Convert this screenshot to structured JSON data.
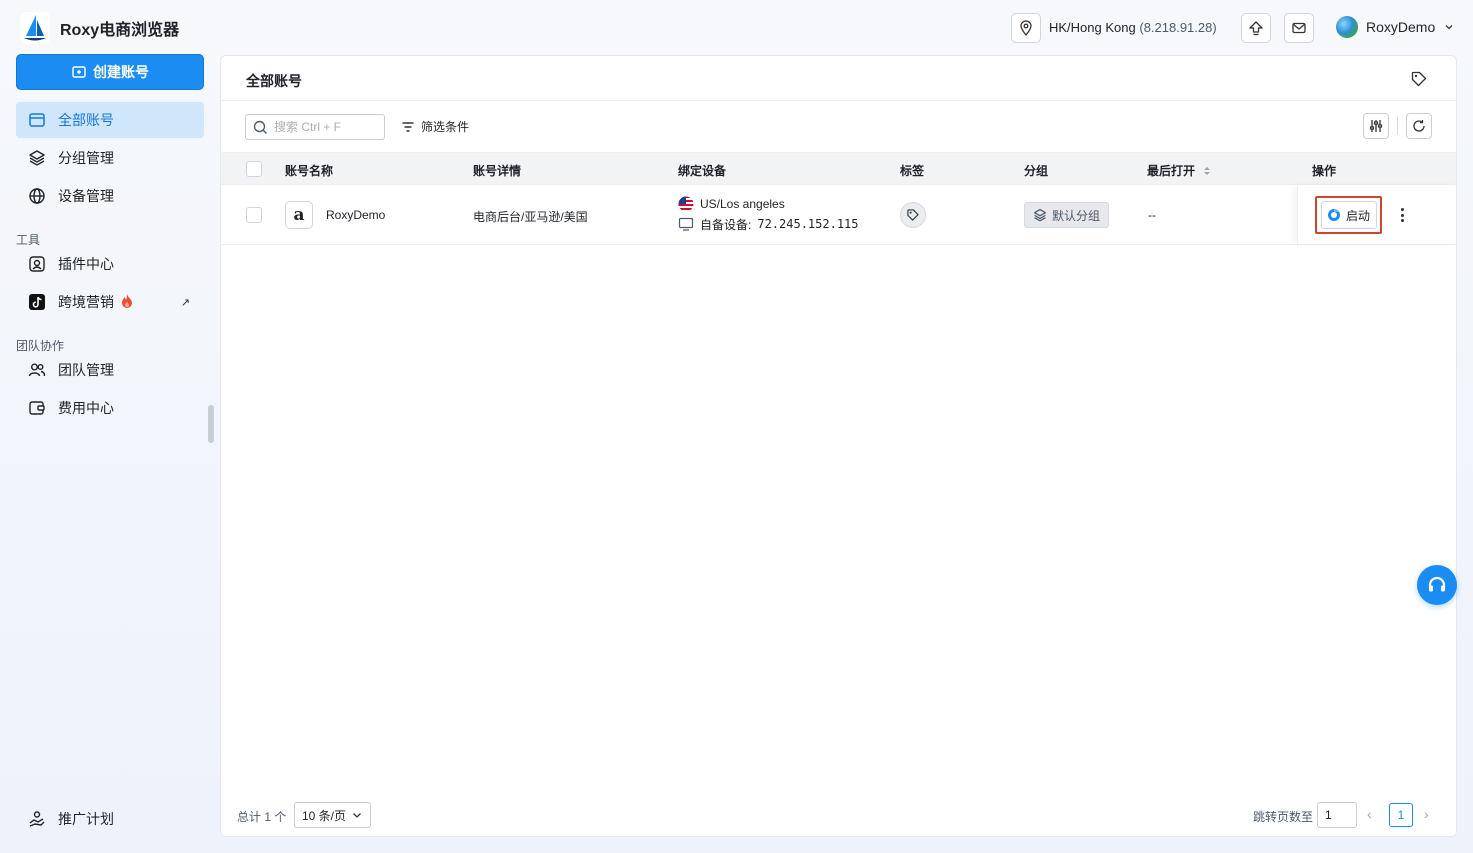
{
  "app": {
    "name": "Roxy电商浏览器"
  },
  "sidebar": {
    "create_label": "创建账号",
    "items": [
      {
        "label": "全部账号",
        "icon": "window-icon",
        "active": true
      },
      {
        "label": "分组管理",
        "icon": "layers-icon"
      },
      {
        "label": "设备管理",
        "icon": "globe-icon"
      }
    ],
    "tools_section": "工具",
    "tools": [
      {
        "label": "插件中心",
        "icon": "plugin-icon"
      },
      {
        "label": "跨境营销",
        "icon": "tiktok-icon",
        "badge_icon": "fire-icon",
        "external": "↗"
      }
    ],
    "team_section": "团队协作",
    "team": [
      {
        "label": "团队管理",
        "icon": "users-icon"
      },
      {
        "label": "费用中心",
        "icon": "wallet-icon"
      }
    ],
    "bottom": {
      "label": "推广计划",
      "icon": "handshake-icon"
    }
  },
  "topbar": {
    "location": "HK/Hong Kong",
    "ip": "(8.218.91.28)",
    "user": "RoxyDemo"
  },
  "main": {
    "title": "全部账号",
    "search_placeholder": "搜索 Ctrl + F",
    "filter_label": "筛选条件",
    "columns": [
      "账号名称",
      "账号详情",
      "绑定设备",
      "标签",
      "分组",
      "最后打开",
      "操作"
    ],
    "rows": [
      {
        "name": "RoxyDemo",
        "platform_icon": "a",
        "detail": "电商后台/亚马逊/美国",
        "device_location": "US/Los angeles",
        "device_label": "自备设备:",
        "device_ip": "72.245.152.115",
        "group": "默认分组",
        "last_opened": "--",
        "action_label": "启动"
      }
    ],
    "footer": {
      "total": "总计 1 个",
      "page_size": "10 条/页",
      "jump_label": "跳转页数至",
      "jump_value": "1",
      "current_page": "1"
    }
  },
  "colors": {
    "accent": "#1a8cf2",
    "highlight_border": "#d0452f",
    "active_bg": "#cfe6fb"
  }
}
